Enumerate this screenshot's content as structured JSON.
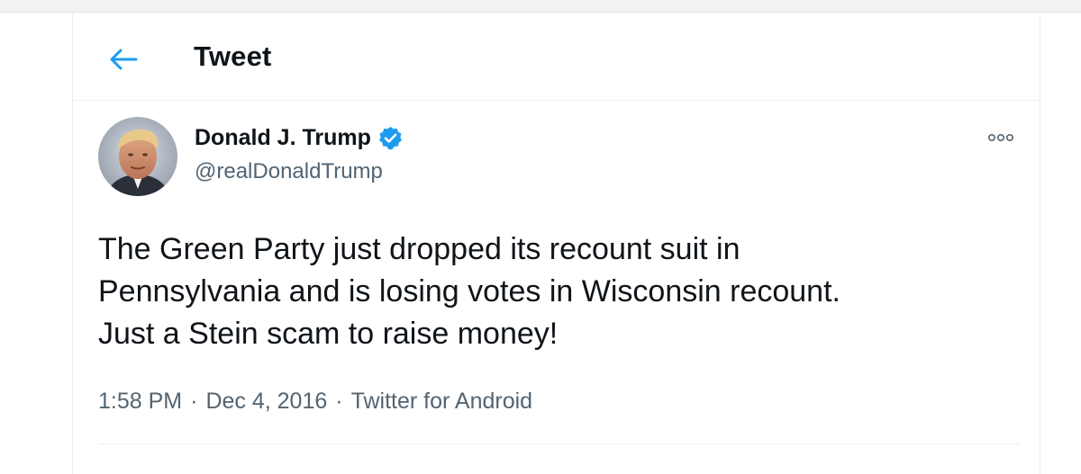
{
  "header": {
    "back_icon": "arrow-left-icon",
    "title": "Tweet"
  },
  "tweet": {
    "author": {
      "name": "Donald J. Trump",
      "handle": "@realDonaldTrump",
      "verified": true,
      "verified_icon": "verified-badge-icon"
    },
    "more_icon": "more-options-icon",
    "text_lines": [
      "The Green Party just dropped its recount suit in",
      "Pennsylvania and is losing votes in Wisconsin recount.",
      "Just a Stein scam to raise money!"
    ],
    "time": "1:58 PM",
    "date": "Dec 4, 2016",
    "separator": "·",
    "source": "Twitter for Android"
  },
  "colors": {
    "accent": "#1d9bf0",
    "text_primary": "#0f1419",
    "text_secondary": "#536471",
    "divider": "#eceef0"
  }
}
